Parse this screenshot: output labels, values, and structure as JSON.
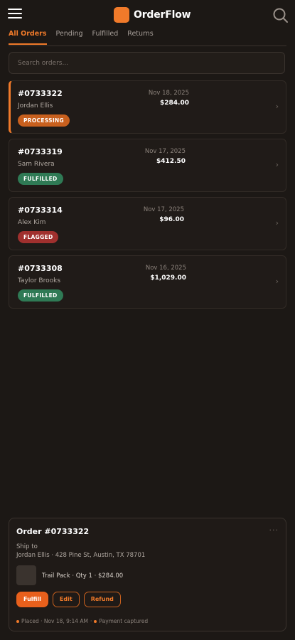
{
  "header": {
    "app_name": "OrderFlow",
    "menu_icon": "hamburger-menu-icon",
    "search_icon": "search-icon",
    "accent_color": "#f07a2a"
  },
  "tabs": [
    {
      "label": "All Orders",
      "active": true
    },
    {
      "label": "Pending",
      "active": false
    },
    {
      "label": "Fulfilled",
      "active": false
    },
    {
      "label": "Returns",
      "active": false
    }
  ],
  "search": {
    "placeholder": "Search orders...",
    "value": ""
  },
  "orders": [
    {
      "id": "#0733322",
      "customer": "Jordan Ellis",
      "date": "Nov 18, 2025",
      "total": "$284.00",
      "status": "PROCESSING",
      "selected": true
    },
    {
      "id": "#0733319",
      "customer": "Sam Rivera",
      "date": "Nov 17, 2025",
      "total": "$412.50",
      "status": "FULFILLED",
      "selected": false
    },
    {
      "id": "#0733314",
      "customer": "Alex Kim",
      "date": "Nov 17, 2025",
      "total": "$96.00",
      "status": "FLAGGED",
      "selected": false
    },
    {
      "id": "#0733308",
      "customer": "Taylor Brooks",
      "date": "Nov 16, 2025",
      "total": "$1,029.00",
      "status": "FULFILLED",
      "selected": false
    }
  ],
  "status_colors": {
    "PROCESSING": "#c8601e",
    "FULFILLED": "#2f7a55",
    "FLAGGED": "#a0302e"
  },
  "detail": {
    "title": "Order #0733322",
    "more_label": "···",
    "ship_label": "Ship to",
    "ship_address": "Jordan Ellis · 428 Pine St, Austin, TX 78701",
    "item_text": "Trail Pack · Qty 1 · $284.00",
    "actions": {
      "fulfill": "Fulfill",
      "edit": "Edit",
      "refund": "Refund"
    },
    "meta": {
      "placed": "Placed · Nov 18, 9:14 AM",
      "separator": "·",
      "payment": "Payment captured"
    }
  }
}
